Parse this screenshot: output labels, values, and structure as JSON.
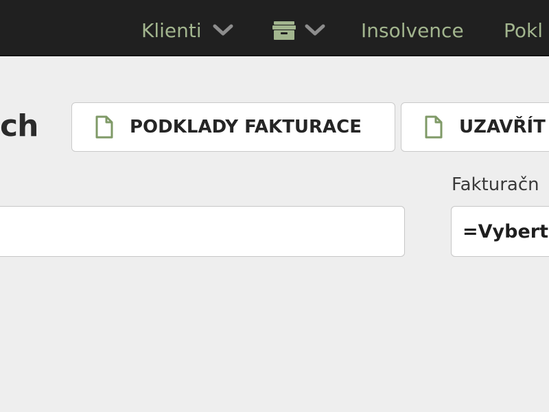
{
  "nav": {
    "klienti_label": "Klienti",
    "insolvence_label": "Insolvence",
    "pokl_label": "Pokl",
    "accent_color": "#a2b58e",
    "icons": [
      "chevron-down-icon",
      "archive-box-icon"
    ]
  },
  "page": {
    "title_fragment": "ch"
  },
  "actions": {
    "podklady_label": "PODKLADY FAKTURACE",
    "uzavrit_label": "UZAVŘÍT",
    "icon": "document-icon"
  },
  "form": {
    "fakturacni_label": "Fakturačn",
    "text_input_value": "",
    "select_value": "=Vyberte"
  }
}
